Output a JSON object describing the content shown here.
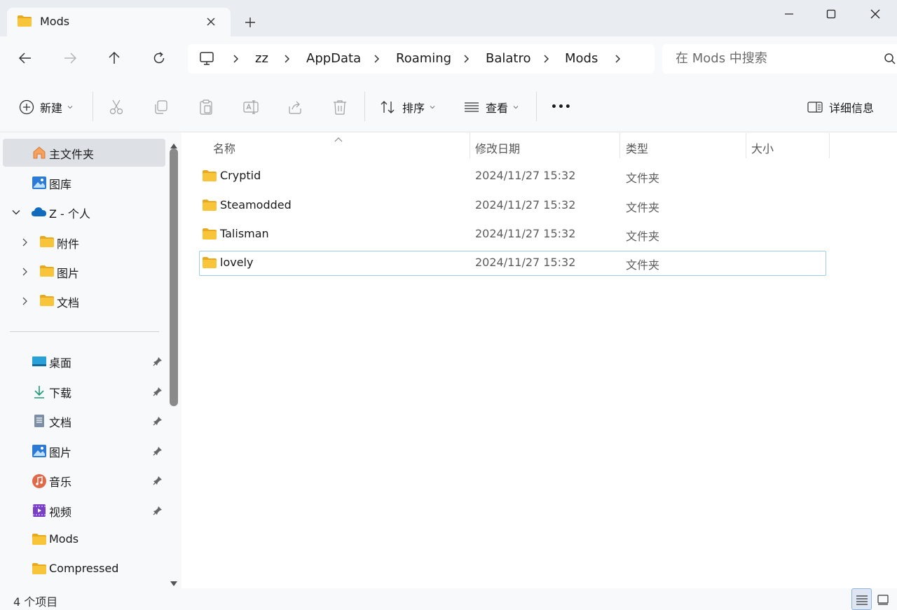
{
  "tab": {
    "title": "Mods",
    "close_glyph": "✕",
    "new_glyph": "+"
  },
  "window": {
    "minimize_glyph": "—",
    "maximize_glyph": "☐",
    "close_glyph": "✕"
  },
  "address": {
    "segments": [
      "zz",
      "AppData",
      "Roaming",
      "Balatro",
      "Mods"
    ]
  },
  "search": {
    "placeholder": "在 Mods 中搜索"
  },
  "toolbar": {
    "new_label": "新建",
    "sort_label": "排序",
    "view_label": "查看",
    "more_label": "•••",
    "details_label": "详细信息"
  },
  "sidebar": {
    "home": "主文件夹",
    "gallery": "图库",
    "onedrive": "Z - 个人",
    "onedrive_children": [
      "附件",
      "图片",
      "文档"
    ],
    "quick_access": [
      {
        "label": "桌面",
        "icon": "desktop-icon",
        "pinned": true
      },
      {
        "label": "下载",
        "icon": "download-icon",
        "pinned": true
      },
      {
        "label": "文档",
        "icon": "documents-icon",
        "pinned": true
      },
      {
        "label": "图片",
        "icon": "pictures-icon",
        "pinned": true
      },
      {
        "label": "音乐",
        "icon": "music-icon",
        "pinned": true
      },
      {
        "label": "视频",
        "icon": "videos-icon",
        "pinned": true
      },
      {
        "label": "Mods",
        "icon": "folder-icon",
        "pinned": false
      },
      {
        "label": "Compressed",
        "icon": "folder-icon",
        "pinned": false
      }
    ]
  },
  "columns": {
    "name": "名称",
    "date": "修改日期",
    "type": "类型",
    "size": "大小"
  },
  "files": [
    {
      "name": "Cryptid",
      "date": "2024/11/27 15:32",
      "type": "文件夹",
      "size": ""
    },
    {
      "name": "Steamodded",
      "date": "2024/11/27 15:32",
      "type": "文件夹",
      "size": ""
    },
    {
      "name": "Talisman",
      "date": "2024/11/27 15:32",
      "type": "文件夹",
      "size": ""
    },
    {
      "name": "lovely",
      "date": "2024/11/27 15:32",
      "type": "文件夹",
      "size": ""
    }
  ],
  "status": {
    "item_count": "4 个项目"
  },
  "colors": {
    "accent": "#0067c0",
    "folder": "#f8c43a",
    "folder_dark": "#e7a91f",
    "focus_border": "#9bcfe9"
  }
}
